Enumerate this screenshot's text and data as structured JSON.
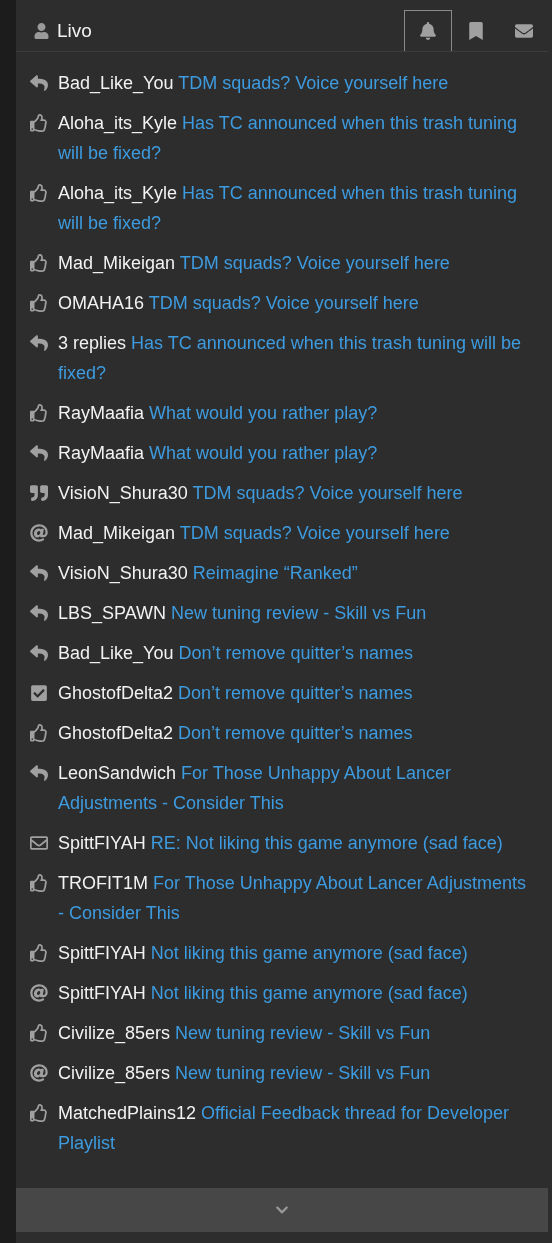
{
  "header": {
    "user": "Livo",
    "tabs": [
      {
        "kind": "bell",
        "selected": true
      },
      {
        "kind": "bookmark",
        "selected": false
      },
      {
        "kind": "envelope",
        "selected": false
      }
    ]
  },
  "notifications": [
    {
      "kind": "reply",
      "user": "Bad_Like_You",
      "topic": "TDM squads? Voice yourself here"
    },
    {
      "kind": "like",
      "user": "Aloha_its_Kyle",
      "topic": "Has TC announced when this trash tuning will be fixed?"
    },
    {
      "kind": "like",
      "user": "Aloha_its_Kyle",
      "topic": "Has TC announced when this trash tuning will be fixed?"
    },
    {
      "kind": "like",
      "user": "Mad_Mikeigan",
      "topic": "TDM squads? Voice yourself here"
    },
    {
      "kind": "like",
      "user": "OMAHA16",
      "topic": "TDM squads? Voice yourself here"
    },
    {
      "kind": "reply",
      "user": "3 replies",
      "topic": "Has TC announced when this trash tuning will be fixed?"
    },
    {
      "kind": "like",
      "user": "RayMaafia",
      "topic": "What would you rather play?"
    },
    {
      "kind": "reply",
      "user": "RayMaafia",
      "topic": "What would you rather play?"
    },
    {
      "kind": "quote",
      "user": "VisioN_Shura30",
      "topic": "TDM squads? Voice yourself here"
    },
    {
      "kind": "mention",
      "user": "Mad_Mikeigan",
      "topic": "TDM squads? Voice yourself here"
    },
    {
      "kind": "reply",
      "user": "VisioN_Shura30",
      "topic": "Reimagine “Ranked”"
    },
    {
      "kind": "reply",
      "user": "LBS_SPAWN",
      "topic": "New tuning review - Skill vs Fun"
    },
    {
      "kind": "reply",
      "user": "Bad_Like_You",
      "topic": "Don’t remove quitter’s names"
    },
    {
      "kind": "solved",
      "user": "GhostofDelta2",
      "topic": "Don’t remove quitter’s names"
    },
    {
      "kind": "like",
      "user": "GhostofDelta2",
      "topic": "Don’t remove quitter’s names"
    },
    {
      "kind": "reply",
      "user": "LeonSandwich",
      "topic": "For Those Unhappy About Lancer Adjustments - Consider This"
    },
    {
      "kind": "message",
      "user": "SpittFIYAH",
      "topic": "RE: Not liking this game anymore (sad face)"
    },
    {
      "kind": "like",
      "user": "TROFIT1M",
      "topic": "For Those Unhappy About Lancer Adjustments - Consider This"
    },
    {
      "kind": "like",
      "user": "SpittFIYAH",
      "topic": "Not liking this game anymore (sad face)"
    },
    {
      "kind": "mention",
      "user": "SpittFIYAH",
      "topic": "Not liking this game anymore (sad face)"
    },
    {
      "kind": "like",
      "user": "Civilize_85ers",
      "topic": "New tuning review - Skill vs Fun"
    },
    {
      "kind": "mention",
      "user": "Civilize_85ers",
      "topic": "New tuning review - Skill vs Fun"
    },
    {
      "kind": "like",
      "user": "MatchedPlains12",
      "topic": "Official Feedback thread for Developer Playlist"
    }
  ]
}
